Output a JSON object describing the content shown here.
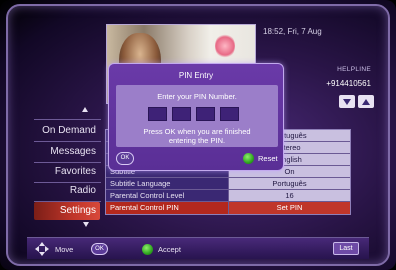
{
  "status": {
    "datetime": "18:52, Fri, 7 Aug"
  },
  "helpline": {
    "label": "HELPLINE",
    "number": "+914410561"
  },
  "menu": {
    "items": [
      {
        "label": "On Demand"
      },
      {
        "label": "Messages"
      },
      {
        "label": "Favorites"
      },
      {
        "label": "Radio"
      },
      {
        "label": "Settings"
      }
    ],
    "selected": "Settings"
  },
  "settings": {
    "rows": [
      {
        "label": "",
        "value": "Português"
      },
      {
        "label": "",
        "value": "Stereo"
      },
      {
        "label": "",
        "value": "English"
      },
      {
        "label": "Subtitle",
        "value": "On"
      },
      {
        "label": "Subtitle Language",
        "value": "Português"
      },
      {
        "label": "Parental Control Level",
        "value": "16"
      },
      {
        "label": "Parental Control PIN",
        "value": "Set PIN"
      }
    ]
  },
  "pin_dialog": {
    "title": "PIN Entry",
    "prompt": "Enter your PIN Number.",
    "instruction_line1": "Press OK when you are finished",
    "instruction_line2": "entering the PIN.",
    "ok_label": "OK",
    "reset_label": "Reset"
  },
  "bottom_bar": {
    "move_label": "Move",
    "ok_label": "OK",
    "accept_label": "Accept",
    "last_label": "Last"
  },
  "colors": {
    "background": "#2a1548",
    "accent_red": "#c0362a",
    "dialog_purple": "#6a3aa8",
    "green_button": "#2ea51f"
  }
}
